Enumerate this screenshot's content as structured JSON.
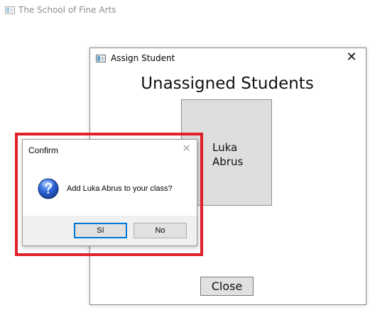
{
  "main_window": {
    "title": "The School of Fine Arts",
    "icon": "app-window-icon"
  },
  "assign_dialog": {
    "title": "Assign Student",
    "icon": "app-window-icon",
    "close_glyph": "✕",
    "heading": "Unassigned Students",
    "student_card": {
      "name": "Luka Abrus"
    },
    "close_button": "Close"
  },
  "confirm_dialog": {
    "title": "Confirm",
    "close_glyph": "✕",
    "icon": "question-icon",
    "message": "Add Luka Abrus to your class?",
    "yes_button": "Sí",
    "no_button": "No"
  },
  "colors": {
    "highlight": "#e0202a",
    "card_background": "#dedede",
    "focus_border": "#0078d7"
  }
}
